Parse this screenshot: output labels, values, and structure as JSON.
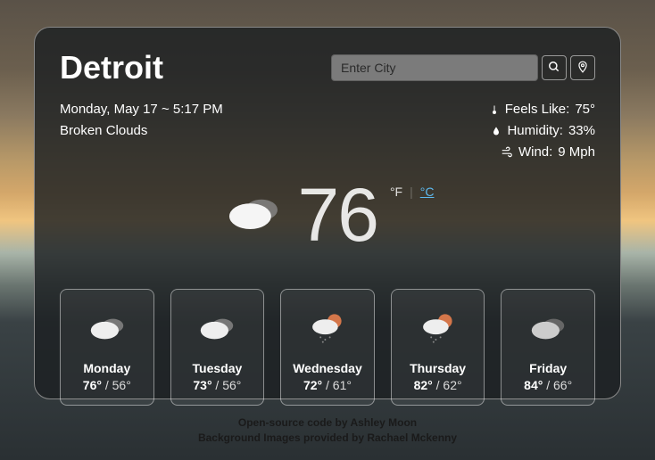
{
  "city": "Detroit",
  "search": {
    "placeholder": "Enter City"
  },
  "datetime": "Monday, May 17 ~ 5:17 PM",
  "condition": "Broken Clouds",
  "feels_like_label": "Feels Like:",
  "feels_like_value": "75°",
  "humidity_label": "Humidity:",
  "humidity_value": "33%",
  "wind_label": "Wind:",
  "wind_value": "9 Mph",
  "current_temp": "76",
  "unit_f": "°F",
  "unit_c": "°C",
  "forecast": [
    {
      "name": "Monday",
      "hi": "76°",
      "lo": " / 56°"
    },
    {
      "name": "Tuesday",
      "hi": "73°",
      "lo": " / 56°"
    },
    {
      "name": "Wednesday",
      "hi": "72°",
      "lo": " / 61°"
    },
    {
      "name": "Thursday",
      "hi": "82°",
      "lo": " / 62°"
    },
    {
      "name": "Friday",
      "hi": "84°",
      "lo": " / 66°"
    }
  ],
  "footer_line1": "Open-source code by Ashley Moon",
  "footer_line2": "Background Images provided by Rachael Mckenny"
}
